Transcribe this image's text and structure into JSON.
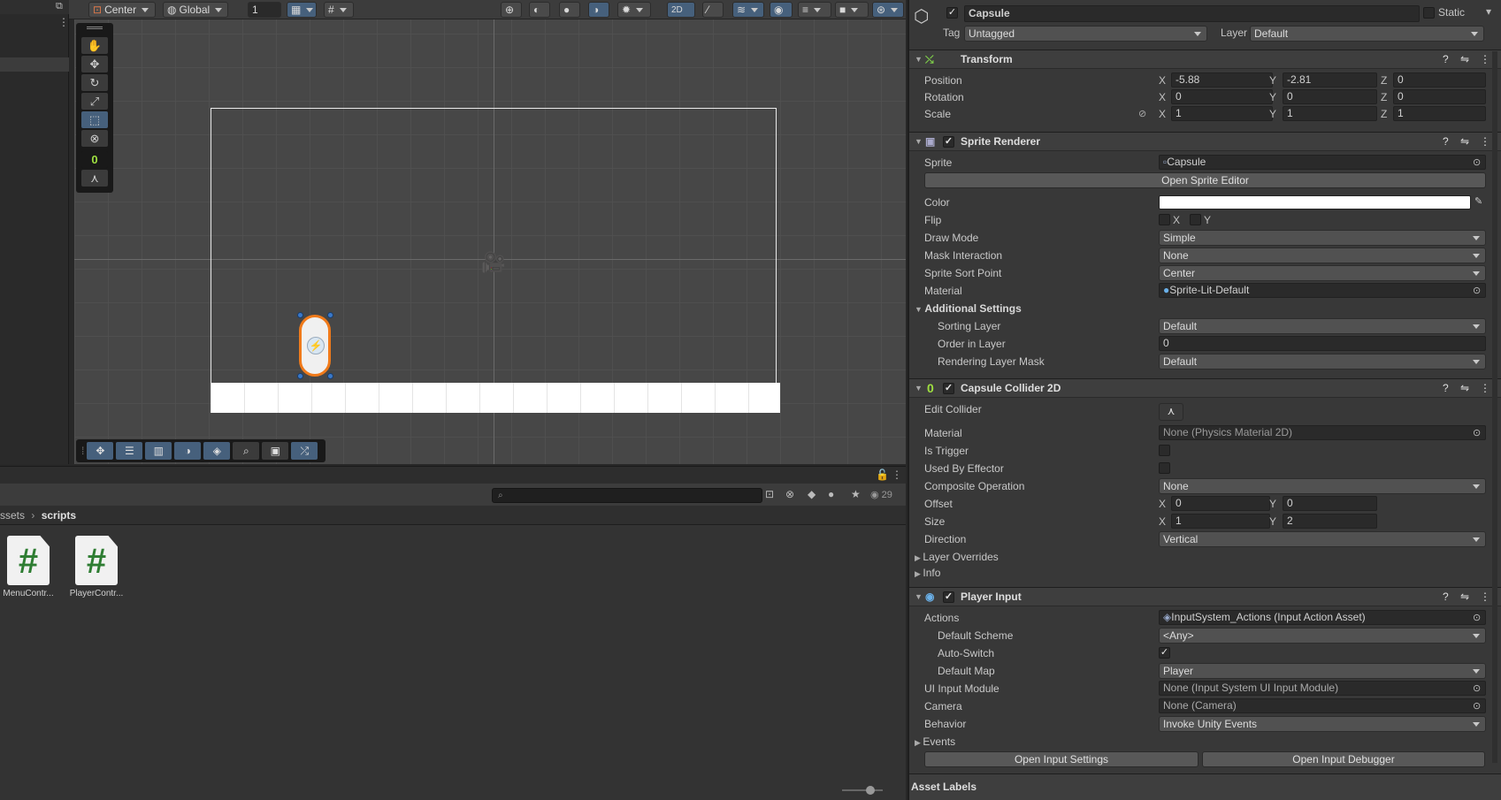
{
  "scene_toolbar": {
    "pivot": "Center",
    "space": "Global",
    "increment": "1",
    "mode_2d": "2D"
  },
  "project": {
    "breadcrumb_parent": "ssets",
    "breadcrumb_current": "scripts",
    "hidden_count": "29",
    "search_icon": "search-icon",
    "assets": [
      {
        "name": "MenuContr...",
        "icon": "#"
      },
      {
        "name": "PlayerContr...",
        "icon": "#"
      }
    ]
  },
  "inspector": {
    "object_name": "Capsule",
    "static_label": "Static",
    "tag_label": "Tag",
    "tag_value": "Untagged",
    "layer_label": "Layer",
    "layer_value": "Default",
    "transform": {
      "title": "Transform",
      "position_label": "Position",
      "pos_x": "-5.88",
      "pos_y": "-2.81",
      "pos_z": "0",
      "rotation_label": "Rotation",
      "rot_x": "0",
      "rot_y": "0",
      "rot_z": "0",
      "scale_label": "Scale",
      "scl_x": "1",
      "scl_y": "1",
      "scl_z": "1"
    },
    "axes": {
      "x": "X",
      "y": "Y",
      "z": "Z"
    },
    "sprite_renderer": {
      "title": "Sprite Renderer",
      "sprite_label": "Sprite",
      "sprite_value": "Capsule",
      "open_editor": "Open Sprite Editor",
      "color_label": "Color",
      "color_value": "#ffffff",
      "flip_label": "Flip",
      "draw_mode_label": "Draw Mode",
      "draw_mode": "Simple",
      "mask_label": "Mask Interaction",
      "mask": "None",
      "sort_point_label": "Sprite Sort Point",
      "sort_point": "Center",
      "material_label": "Material",
      "material": "Sprite-Lit-Default",
      "additional_label": "Additional Settings",
      "sorting_layer_label": "Sorting Layer",
      "sorting_layer": "Default",
      "order_label": "Order in Layer",
      "order": "0",
      "rlm_label": "Rendering Layer Mask",
      "rlm": "Default"
    },
    "collider": {
      "title": "Capsule Collider 2D",
      "edit_label": "Edit Collider",
      "material_label": "Material",
      "material": "None (Physics Material 2D)",
      "trigger_label": "Is Trigger",
      "effector_label": "Used By Effector",
      "composite_label": "Composite Operation",
      "composite": "None",
      "offset_label": "Offset",
      "off_x": "0",
      "off_y": "0",
      "size_label": "Size",
      "size_x": "1",
      "size_y": "2",
      "direction_label": "Direction",
      "direction": "Vertical",
      "overrides_label": "Layer Overrides",
      "info_label": "Info"
    },
    "player_input": {
      "title": "Player Input",
      "actions_label": "Actions",
      "actions": "InputSystem_Actions (Input Action Asset)",
      "scheme_label": "Default Scheme",
      "scheme": "<Any>",
      "autoswitch_label": "Auto-Switch",
      "map_label": "Default Map",
      "map": "Player",
      "uimodule_label": "UI Input Module",
      "uimodule": "None (Input System UI Input Module)",
      "camera_label": "Camera",
      "camera": "None (Camera)",
      "behavior_label": "Behavior",
      "behavior": "Invoke Unity Events",
      "events_label": "Events",
      "open_settings": "Open Input Settings",
      "open_debugger": "Open Input Debugger"
    },
    "asset_labels": "Asset Labels"
  }
}
